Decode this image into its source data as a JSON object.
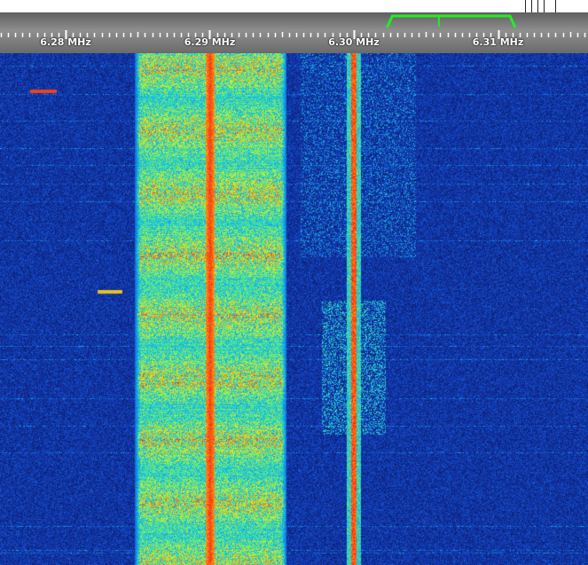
{
  "scale": {
    "labels": [
      {
        "text": "6.28 MHz",
        "freq_mhz": 6.28
      },
      {
        "text": "6.29 MHz",
        "freq_mhz": 6.29
      },
      {
        "text": "6.30 MHz",
        "freq_mhz": 6.3
      },
      {
        "text": "6.31 MHz",
        "freq_mhz": 6.31
      }
    ],
    "passband": {
      "low_mhz": 6.3023,
      "high_mhz": 6.3112,
      "carrier_mhz": 6.3059
    }
  },
  "colors": {
    "passband": "#22ee22",
    "tick": "#ffffff",
    "label": "#ffffff",
    "background": "#0a1d66"
  },
  "waterfall": {
    "signals": [
      {
        "type": "broadband-voice",
        "low_mhz": 6.2848,
        "high_mhz": 6.2953,
        "carrier_mhz": 6.29
      },
      {
        "type": "carrier",
        "freq_mhz": 6.3
      }
    ]
  }
}
